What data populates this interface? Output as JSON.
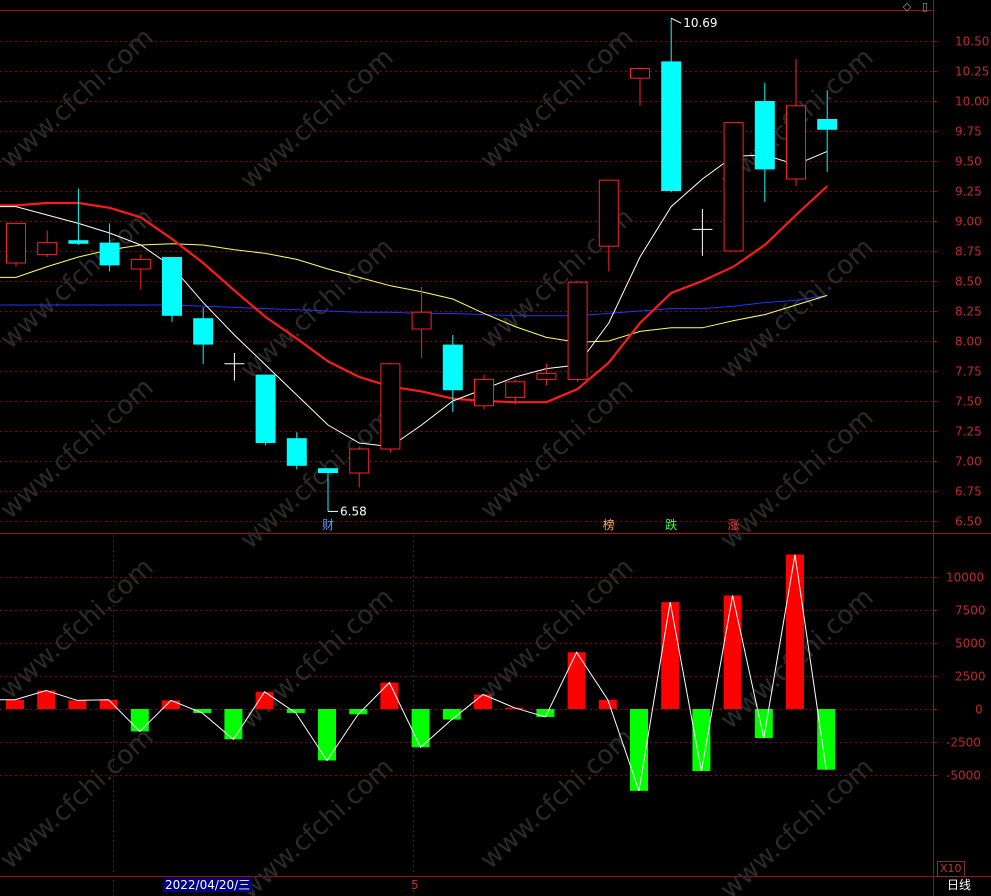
{
  "window": {
    "icons": [
      "diamond-icon",
      "scroll-icon"
    ],
    "date_cursor_label": "2022/04/20/三",
    "period_label": "日线",
    "tick_label": "5",
    "scale_label": "X10"
  },
  "watermark": "www.cfchi.com",
  "colors": {
    "background": "#000000",
    "up": "#ff2020",
    "down": "#00ffff",
    "vol_up": "#ff0000",
    "vol_down": "#00ff00",
    "ma5": "#ffffff",
    "ma10": "#ff1a1a",
    "ma20": "#ffff66",
    "ma60": "#2233ff",
    "grid": "#8b0000",
    "axis_text": "#c02828"
  },
  "chart_data": [
    {
      "type": "candlestick",
      "panel": "price",
      "y_ticks": [
        "10.50",
        "10.25",
        "10.00",
        "9.75",
        "9.50",
        "9.25",
        "9.00",
        "8.75",
        "8.50",
        "8.25",
        "8.00",
        "7.75",
        "7.50",
        "7.25",
        "7.00",
        "6.75",
        "6.50"
      ],
      "ylim": [
        6.45,
        10.75
      ],
      "candles": [
        {
          "o": 8.65,
          "h": 8.98,
          "l": 8.62,
          "c": 8.98
        },
        {
          "o": 8.72,
          "h": 8.92,
          "l": 8.7,
          "c": 8.82
        },
        {
          "o": 8.84,
          "h": 9.27,
          "l": 8.8,
          "c": 8.81
        },
        {
          "o": 8.82,
          "h": 8.98,
          "l": 8.58,
          "c": 8.63
        },
        {
          "o": 8.6,
          "h": 8.72,
          "l": 8.43,
          "c": 8.68
        },
        {
          "o": 8.7,
          "h": 8.7,
          "l": 8.16,
          "c": 8.21
        },
        {
          "o": 8.19,
          "h": 8.28,
          "l": 7.81,
          "c": 7.97
        },
        {
          "o": 7.81,
          "h": 7.9,
          "l": 7.67,
          "c": 7.81
        },
        {
          "o": 7.72,
          "h": 7.72,
          "l": 7.13,
          "c": 7.15
        },
        {
          "o": 7.19,
          "h": 7.24,
          "l": 6.93,
          "c": 6.96
        },
        {
          "o": 6.94,
          "h": 6.94,
          "l": 6.58,
          "c": 6.9
        },
        {
          "o": 6.9,
          "h": 7.12,
          "l": 6.78,
          "c": 7.1
        },
        {
          "o": 7.1,
          "h": 7.82,
          "l": 7.07,
          "c": 7.81
        },
        {
          "o": 8.1,
          "h": 8.45,
          "l": 7.86,
          "c": 8.24
        },
        {
          "o": 7.97,
          "h": 8.05,
          "l": 7.41,
          "c": 7.59
        },
        {
          "o": 7.46,
          "h": 7.72,
          "l": 7.43,
          "c": 7.68
        },
        {
          "o": 7.53,
          "h": 7.68,
          "l": 7.47,
          "c": 7.66
        },
        {
          "o": 7.68,
          "h": 7.81,
          "l": 7.63,
          "c": 7.73
        },
        {
          "o": 7.68,
          "h": 8.5,
          "l": 7.66,
          "c": 8.49
        },
        {
          "o": 8.79,
          "h": 9.34,
          "l": 8.58,
          "c": 9.34
        },
        {
          "o": 10.19,
          "h": 10.28,
          "l": 9.96,
          "c": 10.27
        },
        {
          "o": 10.33,
          "h": 10.69,
          "l": 9.24,
          "c": 9.25
        },
        {
          "o": 8.93,
          "h": 9.1,
          "l": 8.71,
          "c": 8.93
        },
        {
          "o": 8.75,
          "h": 9.82,
          "l": 8.75,
          "c": 9.82
        },
        {
          "o": 10.0,
          "h": 10.15,
          "l": 9.16,
          "c": 9.43
        },
        {
          "o": 9.35,
          "h": 10.35,
          "l": 9.29,
          "c": 9.96
        },
        {
          "o": 9.85,
          "h": 10.09,
          "l": 9.41,
          "c": 9.76
        }
      ],
      "ma5": [
        9.12,
        9.05,
        8.98,
        8.9,
        8.8,
        8.62,
        8.32,
        8.05,
        7.8,
        7.55,
        7.3,
        7.15,
        7.12,
        7.3,
        7.5,
        7.6,
        7.7,
        7.77,
        7.8,
        8.15,
        8.7,
        9.12,
        9.35,
        9.54,
        9.55,
        9.47,
        9.58
      ],
      "ma10": [
        9.13,
        9.15,
        9.15,
        9.11,
        9.03,
        8.85,
        8.65,
        8.42,
        8.2,
        8.02,
        7.83,
        7.7,
        7.62,
        7.58,
        7.52,
        7.5,
        7.49,
        7.49,
        7.6,
        7.82,
        8.15,
        8.4,
        8.5,
        8.62,
        8.8,
        9.05,
        9.29
      ],
      "ma20": [
        8.53,
        8.62,
        8.7,
        8.76,
        8.8,
        8.81,
        8.8,
        8.76,
        8.73,
        8.68,
        8.6,
        8.53,
        8.46,
        8.41,
        8.35,
        8.23,
        8.12,
        8.03,
        7.99,
        8.0,
        8.08,
        8.11,
        8.11,
        8.17,
        8.22,
        8.3,
        8.38
      ],
      "ma60": [
        8.3,
        8.3,
        8.3,
        8.3,
        8.3,
        8.3,
        8.29,
        8.28,
        8.27,
        8.26,
        8.25,
        8.24,
        8.24,
        8.23,
        8.23,
        8.22,
        8.21,
        8.21,
        8.21,
        8.23,
        8.25,
        8.27,
        8.27,
        8.29,
        8.32,
        8.34,
        8.38
      ],
      "annotations": [
        {
          "index": 21,
          "label": "10.69"
        },
        {
          "index": 10,
          "label": "6.58"
        }
      ],
      "event_markers": [
        {
          "index": 10,
          "label": "财",
          "color": "#4aa3ff"
        },
        {
          "index": 19,
          "label": "榜",
          "color": "#ffb060"
        },
        {
          "index": 21,
          "label": "跌",
          "color": "#40ff40"
        },
        {
          "index": 23,
          "label": "涨",
          "color": "#ff4040"
        }
      ]
    },
    {
      "type": "bar",
      "panel": "indicator",
      "y_ticks": [
        "10000",
        "7500",
        "5000",
        "2500",
        "0",
        "-2500",
        "-5000"
      ],
      "ylim": [
        -6000,
        12000
      ],
      "values": [
        700,
        1400,
        650,
        700,
        -1700,
        650,
        -300,
        -2300,
        1300,
        -300,
        -3900,
        -400,
        2000,
        -2900,
        -800,
        1100,
        100,
        -600,
        4300,
        700,
        -6200,
        8100,
        -4700,
        8600,
        -2200,
        11700,
        -4600
      ]
    }
  ]
}
